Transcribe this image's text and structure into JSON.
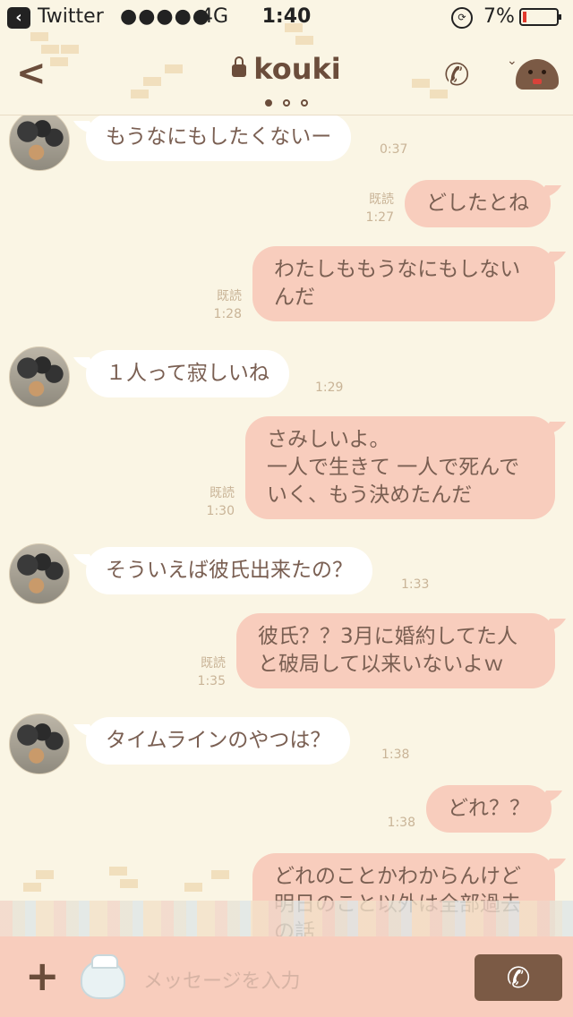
{
  "status_bar": {
    "app": "Twitter",
    "signal": "●●●●●",
    "network": "4G",
    "time": "1:40",
    "battery": "7%",
    "battery_level": 0.07
  },
  "header": {
    "title": "kouki",
    "page_dots": [
      true,
      false,
      false
    ],
    "icons": {
      "back": "chevron-left-icon",
      "lock": "lock-icon",
      "call": "phone-icon",
      "mascot": "mascot-icon"
    }
  },
  "messages": [
    {
      "side": "in",
      "lines": [
        "もうなにもしたくないー"
      ],
      "time": "0:37"
    },
    {
      "side": "out",
      "lines": [
        "どしたとね"
      ],
      "read": "既読",
      "time": "1:27"
    },
    {
      "side": "out",
      "lines": [
        "わたしももうなにもしない",
        "んだ"
      ],
      "read": "既読",
      "time": "1:28"
    },
    {
      "side": "in",
      "lines": [
        "１人って寂しいね"
      ],
      "time": "1:29"
    },
    {
      "side": "out",
      "lines": [
        "さみしいよ。",
        "一人で生きて 一人で死んで",
        "いく、もう決めたんだ"
      ],
      "read": "既読",
      "time": "1:30"
    },
    {
      "side": "in",
      "lines": [
        "そういえば彼氏出来たの？"
      ],
      "time": "1:33"
    },
    {
      "side": "out",
      "lines": [
        "彼氏？？3月に婚約してた人",
        "と破局して以来いないよｗ"
      ],
      "read": "既読",
      "time": "1:35"
    },
    {
      "side": "in",
      "lines": [
        "タイムラインのやつは？"
      ],
      "time": "1:38"
    },
    {
      "side": "out",
      "lines": [
        "どれ？？"
      ],
      "time": "1:38"
    },
    {
      "side": "out",
      "lines": [
        "どれのことかわからんけど",
        "明日のこと以外は全部過去",
        "の話"
      ]
    }
  ],
  "input": {
    "placeholder": "メッセージを入力",
    "icons": {
      "add": "plus-icon",
      "sticker": "sticker-icon",
      "call": "phone-icon"
    }
  }
}
